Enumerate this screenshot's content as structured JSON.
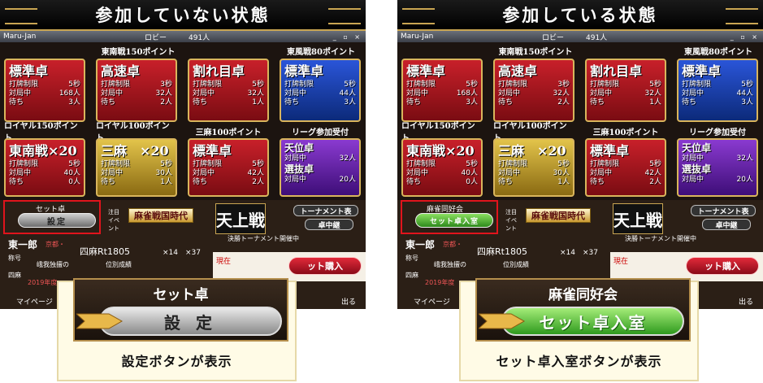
{
  "left": {
    "banner": "参加していない状態",
    "window": {
      "app": "Maru-Jan",
      "lobby": "ロビー",
      "count": "491人",
      "controls": "_ ▫ ×"
    },
    "header_east_south": "東南戦150ポイント",
    "header_east": "東風戦80ポイント",
    "header_royal150": "ロイヤル150ポイント",
    "header_royal100": "ロイヤル100ポイント",
    "header_sanma": "三麻100ポイント",
    "header_league": "リーグ参加受付",
    "cards_row1": [
      {
        "title": "標準卓",
        "l1k": "打牌制限",
        "l1v": "5秒",
        "l2k": "対局中",
        "l2v": "168人",
        "l3k": "待ち",
        "l3v": "3人"
      },
      {
        "title": "高速卓",
        "l1k": "打牌制限",
        "l1v": "3秒",
        "l2k": "対局中",
        "l2v": "32人",
        "l3k": "待ち",
        "l3v": "2人"
      },
      {
        "title": "割れ目卓",
        "l1k": "打牌制限",
        "l1v": "5秒",
        "l2k": "対局中",
        "l2v": "32人",
        "l3k": "待ち",
        "l3v": "1人"
      },
      {
        "title": "標準卓",
        "l1k": "打牌制限",
        "l1v": "5秒",
        "l2k": "対局中",
        "l2v": "44人",
        "l3k": "待ち",
        "l3v": "3人"
      }
    ],
    "cards_row2": [
      {
        "title": "東南戦×20",
        "l1k": "打牌制限",
        "l1v": "5秒",
        "l2k": "対局中",
        "l2v": "40人",
        "l3k": "待ち",
        "l3v": "0人"
      },
      {
        "title": "三麻　×20",
        "l1k": "打牌制限",
        "l1v": "5秒",
        "l2k": "対局中",
        "l2v": "30人",
        "l3k": "待ち",
        "l3v": "1人"
      },
      {
        "title": "標準卓",
        "l1k": "打牌制限",
        "l1v": "5秒",
        "l2k": "対局中",
        "l2v": "42人",
        "l3k": "待ち",
        "l3v": "2人"
      }
    ],
    "league": {
      "a": "天位卓",
      "ak": "対局中",
      "av": "32人",
      "b": "選抜卓",
      "bk": "対局中",
      "bv": "20人"
    },
    "set_label": "セット卓",
    "set_button": "設定",
    "event_label": "注目イベント",
    "event_logo": "麻雀戦国時代",
    "tenjo": "天上戦",
    "tournament": "トーナメント表",
    "relay": "卓中継",
    "tour_msg": "決勝トーナメント開催中",
    "player": "東一郎",
    "player_loc": "京都・",
    "rank": "四麻Rt1805",
    "trophy1": "×14",
    "trophy2": "×37",
    "now": "現在",
    "buy": "ット購入",
    "title_tag": "称号",
    "yomma": "四麻",
    "year": "2019年度",
    "footer_left": "マイページ",
    "footer_right": "出る",
    "title_text": "峨我独擅の",
    "rank_text": "位別成績"
  },
  "right": {
    "banner": "参加している状態",
    "window": {
      "app": "Maru-Jan",
      "lobby": "ロビー",
      "count": "491人",
      "controls": "_ ▫ ×"
    },
    "set_label": "麻雀同好会",
    "set_button": "セット卓入室"
  },
  "zoom_left": {
    "head": "セット卓",
    "button": "設 定",
    "caption": "設定ボタンが表示"
  },
  "zoom_right": {
    "head": "麻雀同好会",
    "button": "セット卓入室",
    "caption": "セット卓入室ボタンが表示"
  }
}
